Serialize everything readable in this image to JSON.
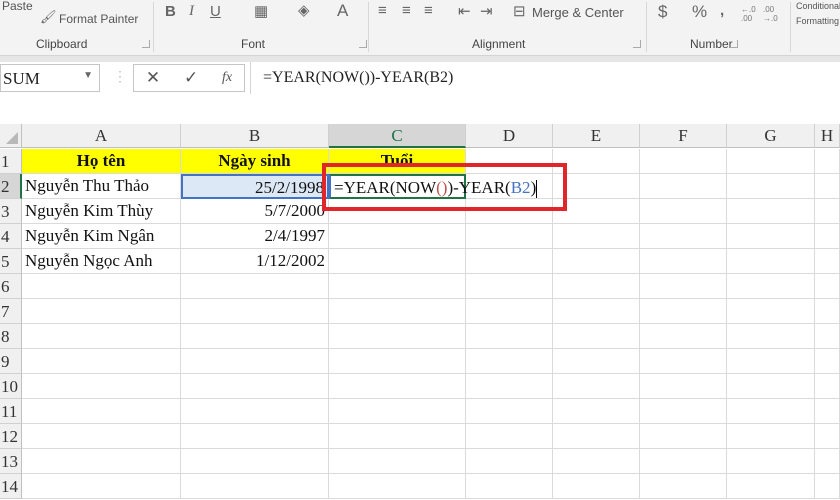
{
  "ribbon": {
    "clipboard": {
      "paste": "Paste",
      "format_painter": "Format Painter",
      "label": "Clipboard"
    },
    "font": {
      "bold": "B",
      "italic": "I",
      "underline": "U",
      "font_color": "A",
      "label": "Font"
    },
    "alignment": {
      "merge_center": "Merge & Center",
      "label": "Alignment"
    },
    "number": {
      "currency": "$",
      "percent": "%",
      "comma": ",",
      "inc_decimal": "←.0 .00",
      "dec_decimal": ".00 →.0",
      "label": "Number"
    },
    "conditional": {
      "line1": "Conditional",
      "line2": "Formatting"
    }
  },
  "formula_bar": {
    "name_box": "SUM",
    "cancel": "✕",
    "enter": "✓",
    "fx": "fx",
    "formula": "=YEAR(NOW())-YEAR(B2)"
  },
  "sheet": {
    "columns": [
      "A",
      "B",
      "C",
      "D",
      "E",
      "F",
      "G",
      "H"
    ],
    "selected_column": "C",
    "rows": [
      "1",
      "2",
      "3",
      "4",
      "5",
      "6",
      "7",
      "8",
      "9",
      "10",
      "11",
      "12",
      "13",
      "14"
    ],
    "selected_row": "2",
    "headers": [
      "Họ tên",
      "Ngày sinh",
      "Tuổi"
    ],
    "data": [
      {
        "name": "Nguyễn Thu Thảo",
        "dob": "25/2/1998"
      },
      {
        "name": "Nguyễn Kim Thùy",
        "dob": "5/7/2000"
      },
      {
        "name": "Nguyễn Kim Ngân",
        "dob": "2/4/1997"
      },
      {
        "name": "Nguyễn Ngọc Anh",
        "dob": "1/12/2002"
      }
    ],
    "editing_cell": {
      "ref": "C2",
      "parts": [
        "=YEAR(NOW",
        "()",
        ")-YEAR(",
        "B2",
        ")"
      ]
    },
    "colors": {
      "header_fill": "#ffff00",
      "highlight_box": "#e0262b",
      "ref_blue": "#4472c4",
      "paren_red": "#c0504d"
    }
  }
}
